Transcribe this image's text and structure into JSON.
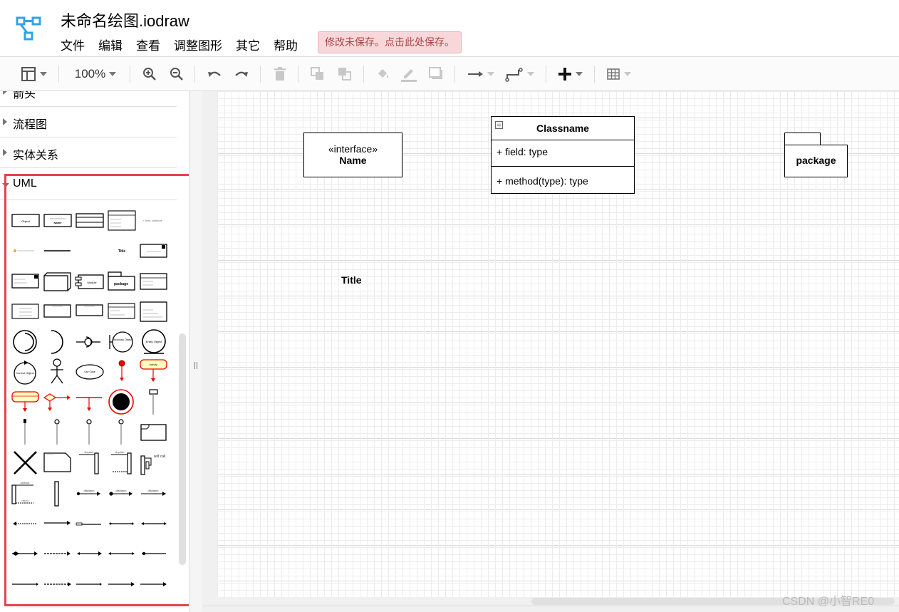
{
  "app": {
    "document_title": "未命名绘图.iodraw",
    "save_warning": "修改未保存。点击此处保存。"
  },
  "menubar": {
    "items": [
      {
        "label": "文件"
      },
      {
        "label": "编辑"
      },
      {
        "label": "查看"
      },
      {
        "label": "调整图形"
      },
      {
        "label": "其它"
      },
      {
        "label": "帮助"
      }
    ]
  },
  "toolbar": {
    "zoom_level": "100%",
    "icons": [
      "layout-panel-icon",
      "zoom-in-icon",
      "zoom-out-icon",
      "undo-icon",
      "redo-icon",
      "delete-icon",
      "to-front-icon",
      "to-back-icon",
      "fill-color-icon",
      "line-color-icon",
      "shadow-icon",
      "connection-icon",
      "waypoints-icon",
      "insert-plus-icon",
      "table-icon"
    ]
  },
  "sidebar": {
    "sections": [
      {
        "label": "箭头",
        "expanded": false
      },
      {
        "label": "流程图",
        "expanded": false
      },
      {
        "label": "实体关系",
        "expanded": false
      },
      {
        "label": "UML",
        "expanded": true
      }
    ],
    "uml_shapes": {
      "object": "Object",
      "interface_name": "Name",
      "attribute": "+ item: attribute",
      "title": "Title",
      "module": "Module",
      "package": "package",
      "boundary": "Boundary Object",
      "entity": "Entity Object",
      "control": "Control Object",
      "use_case": "Use Case",
      "activity": "Activity",
      "dispatch": "dispatch",
      "self_call": "self call",
      "callback": "callback",
      "return": "return"
    }
  },
  "canvas": {
    "interface_stereotype": "«interface»",
    "interface_name": "Name",
    "class_name": "Classname",
    "class_field": "+ field: type",
    "class_method": "+ method(type): type",
    "package_label": "package",
    "title_label": "Title"
  },
  "watermark": "CSDN @小智RE0",
  "colors": {
    "accent_logo": "#2fa4e7",
    "highlight_border": "#e0464b",
    "warning_bg": "#f8d7da",
    "warning_text": "#a94442",
    "uml_activity_fill": "#ffffc0",
    "uml_activity_stroke": "#ff0000"
  }
}
